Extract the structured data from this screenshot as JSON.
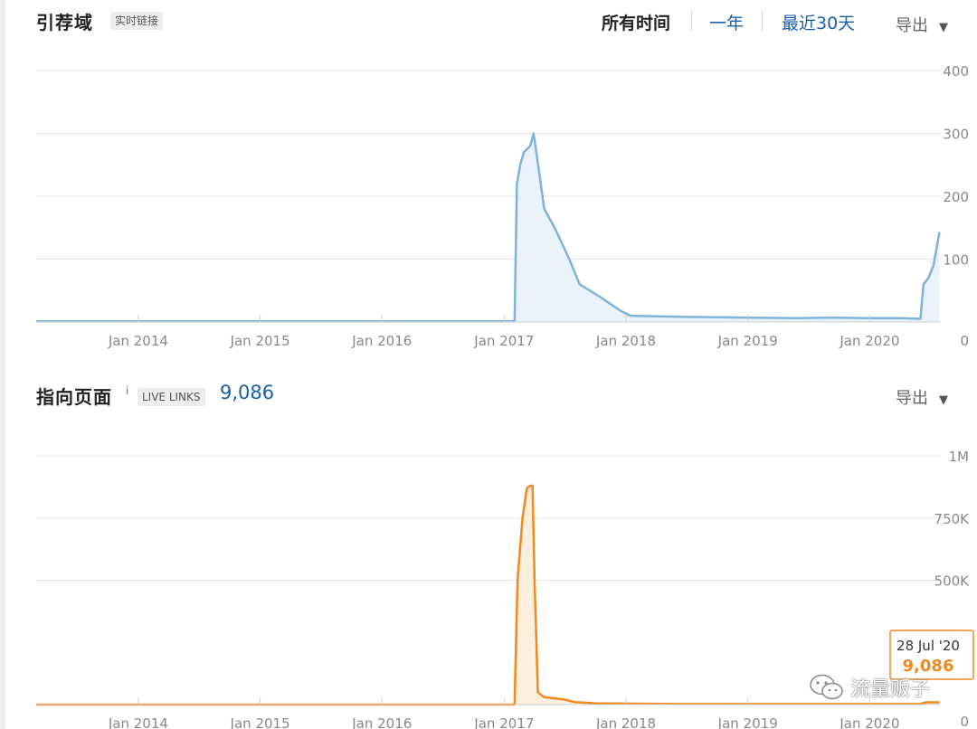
{
  "referring_domains": {
    "title": "引荐域",
    "badge": "实时链接",
    "tabs": {
      "all_time": "所有时间",
      "one_year": "一年",
      "last_30_days": "最近30天"
    },
    "export_label": "导出"
  },
  "referring_pages": {
    "title": "指向页面",
    "info_icon": "i",
    "badge": "LIVE LINKS",
    "live_count": "9,086",
    "export_label": "导出"
  },
  "tooltip": {
    "date": "28 Jul '20",
    "value": "9,086"
  },
  "watermark": {
    "text": "流量贩子",
    "icon": "wechat-icon"
  },
  "colors": {
    "domains_line": "#7fb3da",
    "domains_fill": "#eaf3fb",
    "pages_line": "#f08a1f",
    "pages_fill": "#fdeedd",
    "link_blue": "#1a5fa6",
    "grid": "#e5e5e5"
  },
  "chart_data": [
    {
      "type": "area",
      "x_tick_labels": [
        "Jan 2014",
        "Jan 2015",
        "Jan 2016",
        "Jan 2017",
        "Jan 2018",
        "Jan 2019",
        "Jan 2020"
      ],
      "y_tick_labels": [
        "400",
        "300",
        "200",
        "100",
        "0"
      ],
      "yticks": [
        400,
        300,
        200,
        100,
        0
      ],
      "ylim": [
        0,
        400
      ],
      "xlim": [
        "2013-03-01",
        "2020-08-01"
      ],
      "grid": true,
      "series": [
        {
          "x": [
            "2013-03-01",
            "2017-02-01",
            "2017-02-08",
            "2017-02-18",
            "2017-03-01",
            "2017-03-20",
            "2017-03-25",
            "2017-03-30",
            "2017-04-10",
            "2017-05-01",
            "2017-06-01",
            "2017-07-15",
            "2017-08-15",
            "2017-10-15",
            "2017-12-15",
            "2018-01-15",
            "2018-07-01",
            "2019-01-01",
            "2019-06-01",
            "2019-09-01",
            "2020-01-01",
            "2020-04-01",
            "2020-06-01",
            "2020-06-10",
            "2020-06-25",
            "2020-07-10",
            "2020-07-28"
          ],
          "values": [
            1,
            1,
            220,
            250,
            270,
            280,
            290,
            300,
            260,
            180,
            150,
            100,
            60,
            40,
            18,
            10,
            8,
            7,
            6,
            7,
            6,
            6,
            5,
            60,
            70,
            90,
            143
          ]
        }
      ]
    },
    {
      "type": "area",
      "x_tick_labels": [
        "Jan 2014",
        "Jan 2015",
        "Jan 2016",
        "Jan 2017",
        "Jan 2018",
        "Jan 2019",
        "Jan 2020"
      ],
      "y_tick_labels": [
        "1M",
        "750K",
        "500K",
        "0"
      ],
      "yticks": [
        1000000,
        750000,
        500000,
        0
      ],
      "ylim": [
        0,
        1000000
      ],
      "xlim": [
        "2013-03-01",
        "2020-08-01"
      ],
      "grid": true,
      "series": [
        {
          "x": [
            "2013-03-01",
            "2017-02-01",
            "2017-02-10",
            "2017-02-25",
            "2017-03-10",
            "2017-03-20",
            "2017-03-27",
            "2017-04-02",
            "2017-04-12",
            "2017-05-01",
            "2017-06-01",
            "2017-07-01",
            "2017-08-01",
            "2017-10-01",
            "2018-06-01",
            "2019-06-01",
            "2020-06-01",
            "2020-06-15",
            "2020-07-28"
          ],
          "values": [
            0,
            0,
            500000,
            750000,
            870000,
            880000,
            880000,
            500000,
            50000,
            30000,
            25000,
            20000,
            10000,
            5000,
            2000,
            2000,
            2000,
            9086,
            9086
          ]
        }
      ]
    }
  ]
}
